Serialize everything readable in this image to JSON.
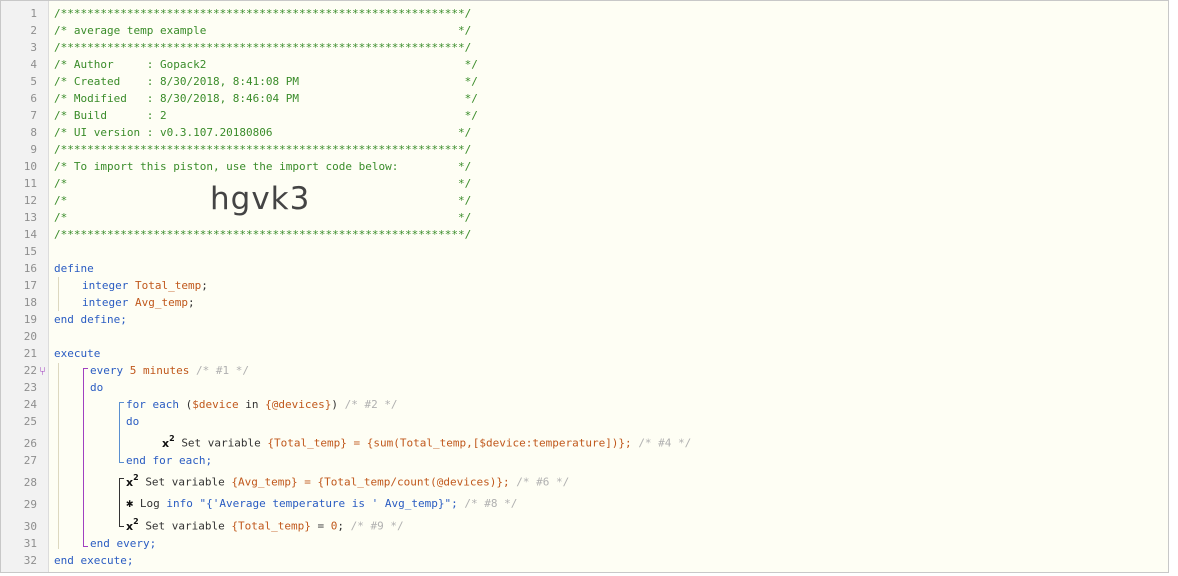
{
  "header": {
    "stars": "/*************************************************************/",
    "title_line": "/* average temp example                                      */",
    "author_line": "/* Author     : Gopack2                                       */",
    "created_line": "/* Created    : 8/30/2018, 8:41:08 PM                         */",
    "modified_line": "/* Modified   : 8/30/2018, 8:46:04 PM                         */",
    "build_line": "/* Build      : 2                                             */",
    "ui_line": "/* UI version : v0.3.107.20180806                            */",
    "import_line": "/* To import this piston, use the import code below:         */",
    "blank_line": "/*                                                           */",
    "import_code": "hgvk3"
  },
  "line_numbers": [
    "1",
    "2",
    "3",
    "4",
    "5",
    "6",
    "7",
    "8",
    "9",
    "10",
    "11",
    "12",
    "13",
    "14",
    "15",
    "16",
    "17",
    "18",
    "19",
    "20",
    "21",
    "22",
    "23",
    "24",
    "25",
    "26",
    "27",
    "28",
    "29",
    "30",
    "31",
    "32"
  ],
  "code": {
    "define": "define",
    "int1_kw": "integer",
    "int1_var": "Total_temp",
    "int2_kw": "integer",
    "int2_var": "Avg_temp",
    "end_define": "end define;",
    "execute": "execute",
    "every_kw": "every",
    "every_num": "5",
    "every_unit": "minutes",
    "every_comment": "/* #1 */",
    "do1": "do",
    "foreach_kw": "for each",
    "foreach_var": "$device",
    "foreach_in": "in",
    "foreach_list": "{@devices}",
    "foreach_comment": "/* #2 */",
    "do2": "do",
    "set1_label": "Set variable",
    "set1_var": "{Total_temp}",
    "set1_expr": "= {sum(Total_temp,[$device:temperature])};",
    "set1_comment": "/* #4 */",
    "end_foreach": "end for each;",
    "set2_label": "Set variable",
    "set2_var": "{Avg_temp}",
    "set2_expr": "= {Total_temp/count(@devices)};",
    "set2_comment": "/* #6 */",
    "log_label": "Log",
    "log_level": "info",
    "log_msg": "\"{'Average temperature is ' Avg_temp}\";",
    "log_comment": "/* #8 */",
    "set3_label": "Set variable",
    "set3_var": "{Total_temp}",
    "set3_eq": "=",
    "set3_val": "0",
    "set3_semi": ";",
    "set3_comment": "/* #9 */",
    "end_every": "end every;",
    "end_execute": "end execute;"
  },
  "colors": {
    "comment": "#3a8c2a",
    "keyword": "#2a5cc2",
    "variable": "#c0581c",
    "faded": "#b0b0b0"
  }
}
